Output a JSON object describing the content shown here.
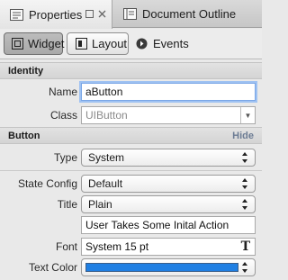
{
  "tabs": [
    {
      "label": "Properties",
      "icon": "properties-icon"
    },
    {
      "label": "Document Outline",
      "icon": "document-outline-icon"
    }
  ],
  "toolbar": {
    "widget_label": "Widget",
    "layout_label": "Layout",
    "events_label": "Events"
  },
  "identity": {
    "header": "Identity",
    "name_label": "Name",
    "name_value": "aButton",
    "class_label": "Class",
    "class_placeholder": "UIButton"
  },
  "button": {
    "header": "Button",
    "hide_label": "Hide",
    "type_label": "Type",
    "type_value": "System",
    "state_config_label": "State Config",
    "state_config_value": "Default",
    "title_label": "Title",
    "title_value": "Plain",
    "title_text": "User Takes Some Inital Action",
    "font_label": "Font",
    "font_value": "System 15 pt",
    "text_color_label": "Text Color",
    "text_color_value": "#1f7fe3"
  },
  "colors": {
    "accent": "#1f7fe3",
    "hide_link": "#6c7c94",
    "focus_ring": "#9fc2f2"
  }
}
